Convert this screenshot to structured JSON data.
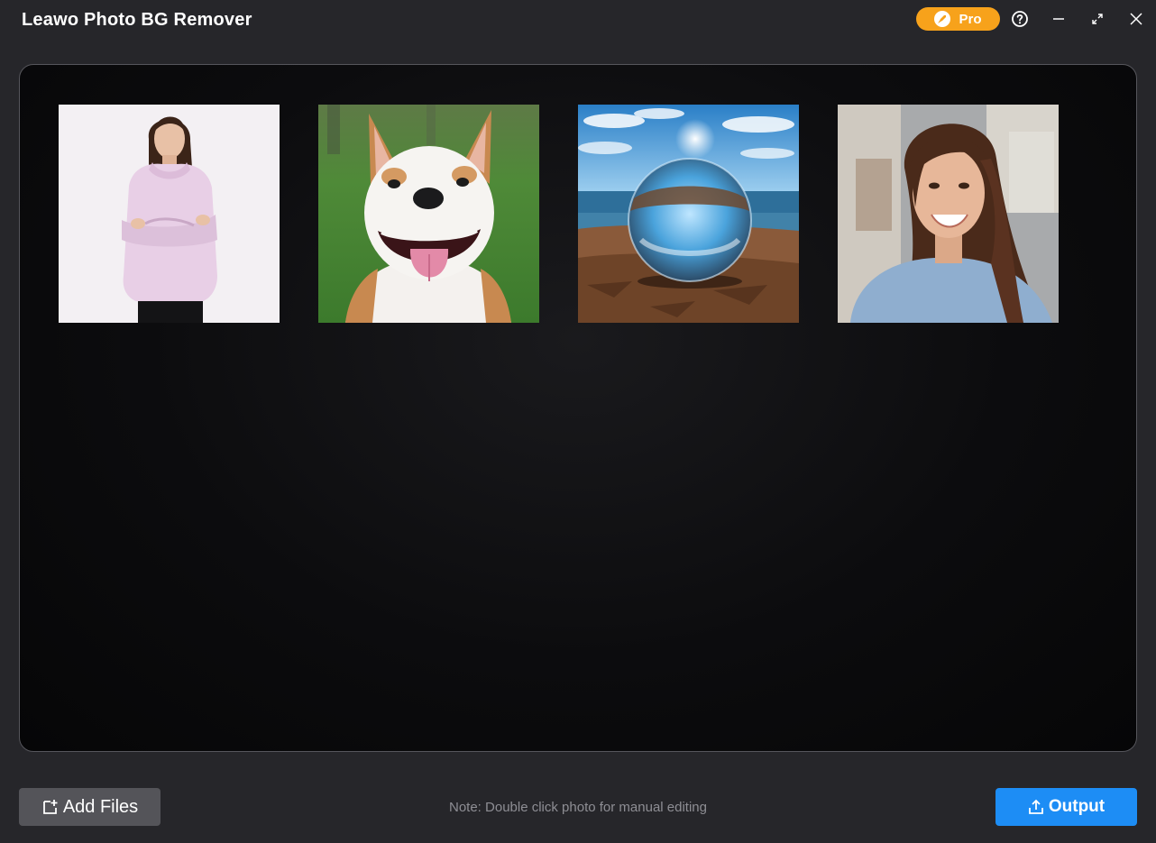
{
  "app": {
    "title": "Leawo Photo BG Remover"
  },
  "header": {
    "pro_label": "Pro",
    "pro_color": "#f7a21b"
  },
  "window_controls": [
    "help-icon",
    "minimize-icon",
    "maximize-icon",
    "close-icon"
  ],
  "photos": [
    {
      "subject": "woman in pink hoodie"
    },
    {
      "subject": "smiling dog"
    },
    {
      "subject": "crystal ball on beach"
    },
    {
      "subject": "smiling woman portrait"
    }
  ],
  "footer": {
    "add_files_label": "Add Files",
    "note": "Note: Double click photo for manual editing",
    "output_label": "Output",
    "output_color": "#1d8df5"
  }
}
